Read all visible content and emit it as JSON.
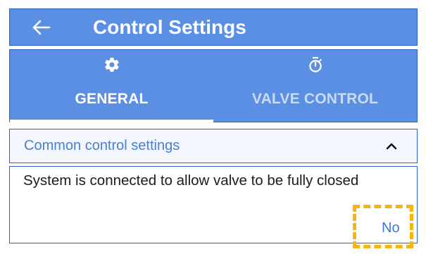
{
  "header": {
    "title": "Control Settings",
    "back_icon": "arrow-left-icon"
  },
  "tabs": [
    {
      "label": "GENERAL",
      "icon": "gear-icon",
      "selected": true
    },
    {
      "label": "VALVE CONTROL",
      "icon": "stopwatch-icon",
      "selected": false
    }
  ],
  "section": {
    "title": "Common control settings",
    "expanded": true,
    "toggle_icon": "chevron-up-icon"
  },
  "setting": {
    "description": "System is connected to allow valve to be fully closed",
    "value": "No"
  },
  "colors": {
    "primary": "#5a8fe3",
    "border": "#2f63c3",
    "accent_text": "#3f78d6",
    "highlight": "#f3b70f"
  }
}
